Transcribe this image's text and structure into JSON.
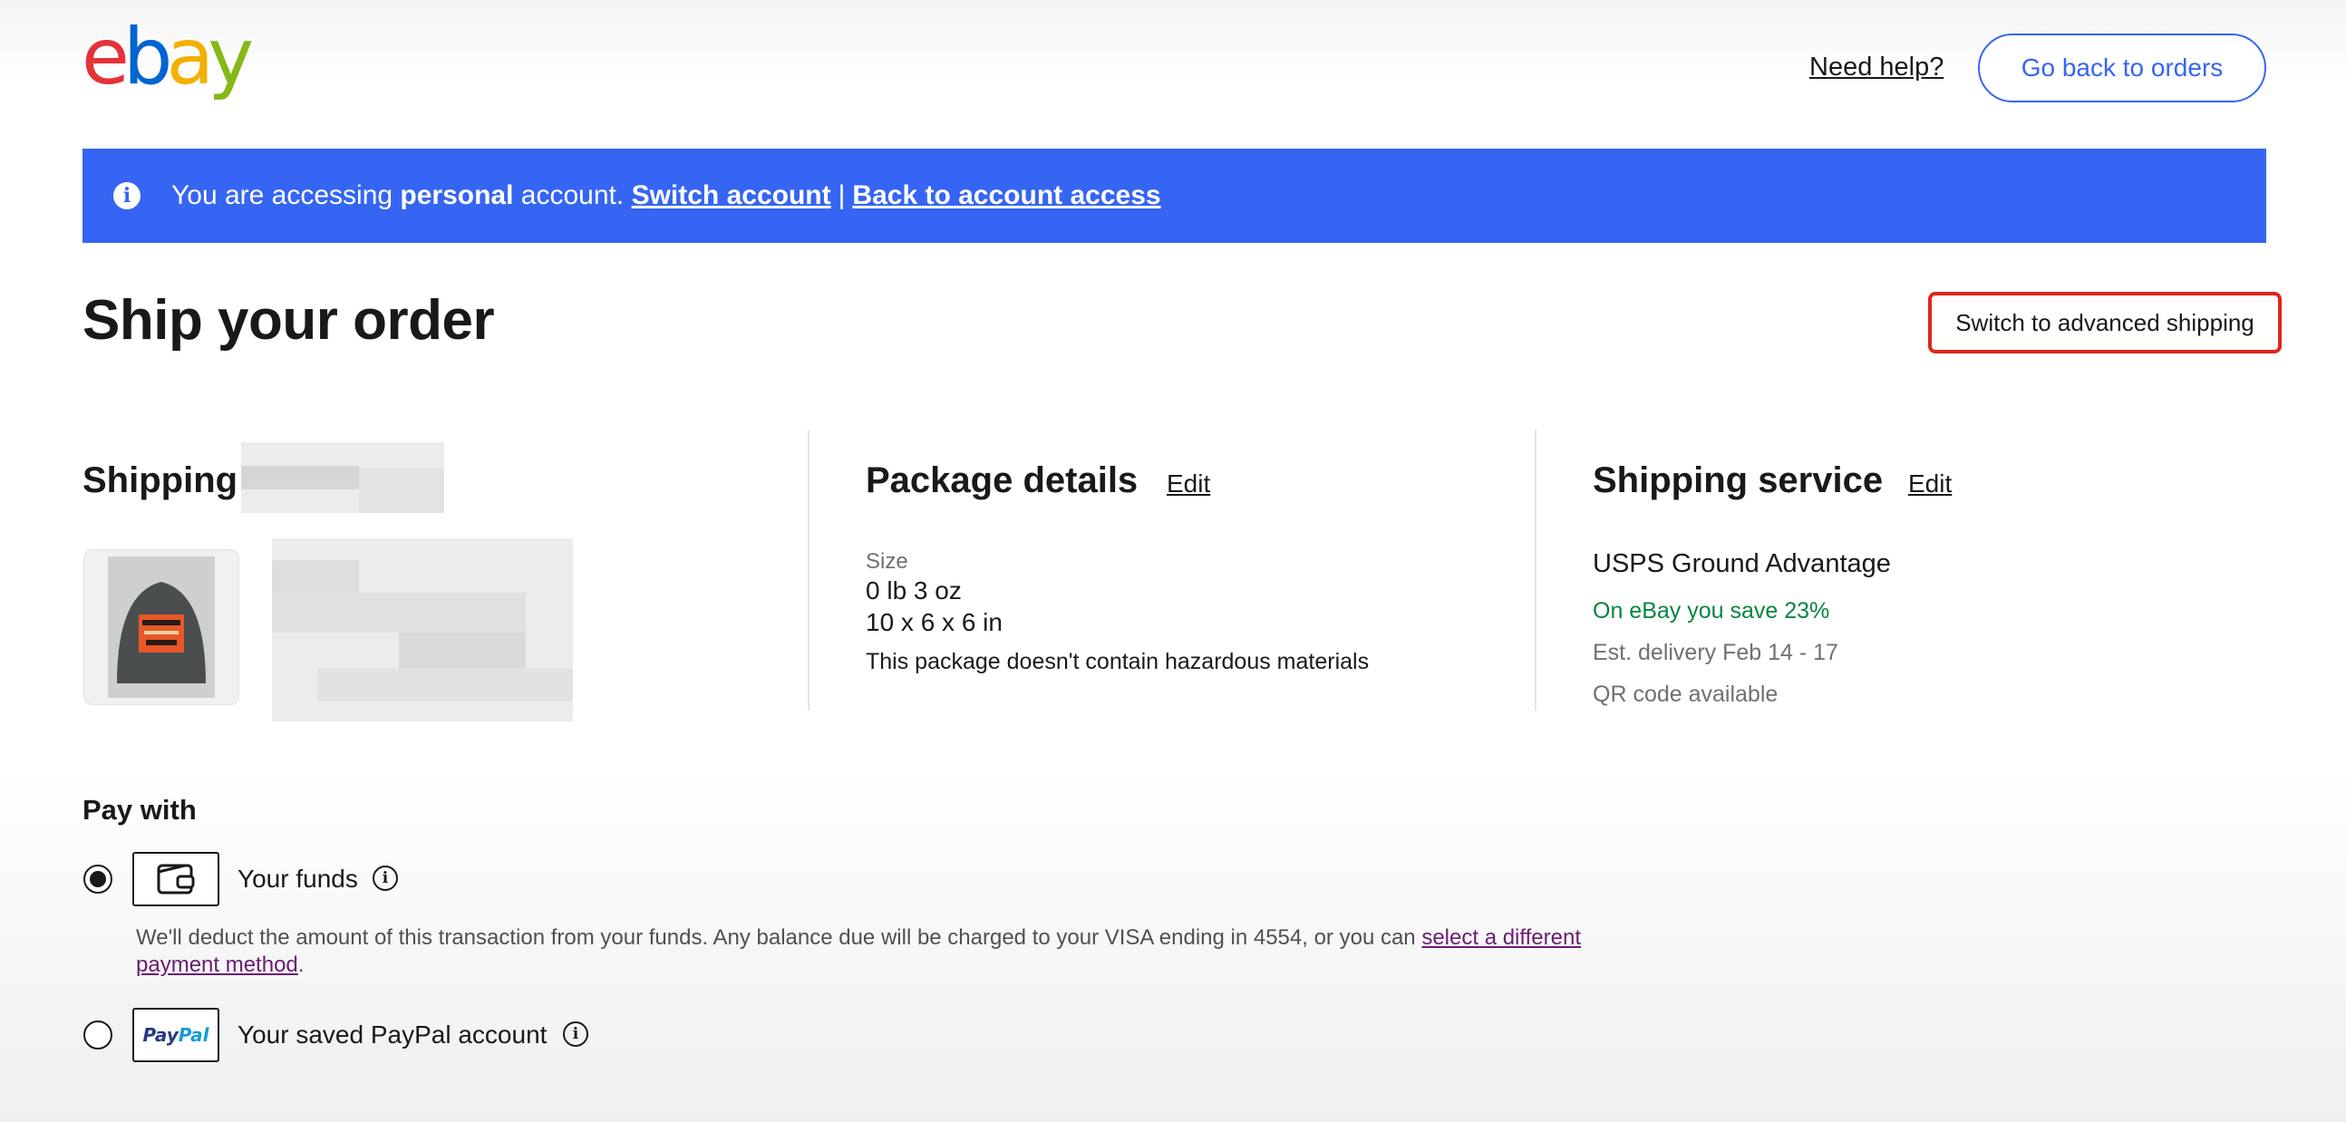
{
  "header": {
    "logo_letters": [
      "e",
      "b",
      "a",
      "y"
    ],
    "need_help": "Need help?",
    "back_button": "Go back to orders"
  },
  "banner": {
    "text_prefix": "You are accessing",
    "account_type": "personal",
    "text_suffix": "account.",
    "switch_account": "Switch account",
    "separator": "|",
    "back_to_access": "Back to account access",
    "color": "#3665f3"
  },
  "page": {
    "title": "Ship your order",
    "advanced_shipping": "Switch to advanced shipping"
  },
  "shipping": {
    "title": "Shipping"
  },
  "package": {
    "title": "Package details",
    "edit": "Edit",
    "size_label": "Size",
    "weight": "0 lb 3 oz",
    "dimensions": "10 x 6 x 6 in",
    "hazard_note": "This package doesn't contain hazardous materials"
  },
  "service": {
    "title": "Shipping service",
    "edit": "Edit",
    "name": "USPS Ground Advantage",
    "savings": "On eBay you save 23%",
    "delivery": "Est. delivery Feb 14 - 17",
    "qr": "QR code available"
  },
  "payment": {
    "title": "Pay with",
    "funds_label": "Your funds",
    "funds_desc": "We'll deduct the amount of this transaction from your funds. Any balance due will be charged to your VISA ending in 4554, or you can",
    "funds_link": "select a different payment method",
    "funds_end": ".",
    "paypal_label": "Your saved PayPal account",
    "paypal_logo_a": "Pay",
    "paypal_logo_b": "Pal"
  },
  "colors": {
    "accent": "#3665f3",
    "highlight_border": "#e2241b",
    "savings_green": "#058540",
    "link_purple": "#6b1c73"
  }
}
